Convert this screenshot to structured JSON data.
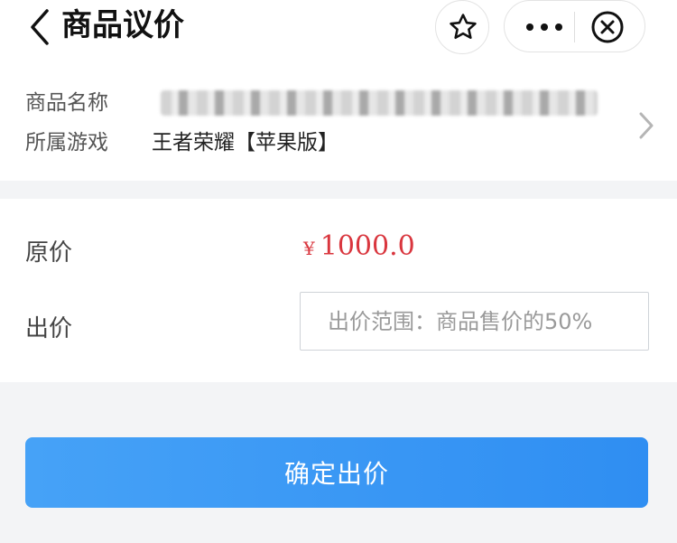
{
  "header": {
    "title": "商品议价",
    "icons": {
      "back": "chevron-left-icon",
      "favorite": "star-icon",
      "more": "more-icon",
      "close": "close-circle-icon"
    }
  },
  "goods": {
    "name_label": "商品名称",
    "name_value": "",
    "game_label": "所属游戏",
    "game_value": "王者荣耀【苹果版】"
  },
  "pricing": {
    "original_label": "原价",
    "currency_symbol": "¥",
    "original_price": "1000.0",
    "bid_label": "出价",
    "bid_placeholder": "出价范围：商品售价的50%",
    "bid_value": ""
  },
  "actions": {
    "confirm_label": "确定出价"
  },
  "colors": {
    "price_red": "#d9363e",
    "primary_blue": "#3a96f5",
    "background_gray": "#f3f4f6"
  }
}
